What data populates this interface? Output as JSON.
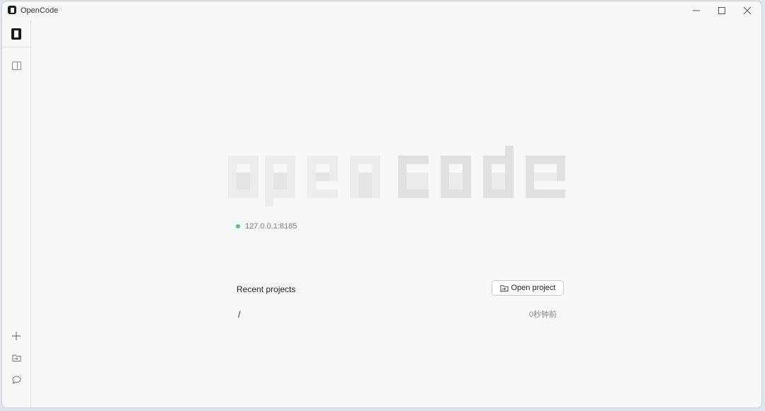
{
  "window": {
    "title": "OpenCode",
    "controls": [
      "minimize-icon",
      "maximize-icon",
      "close-icon"
    ]
  },
  "sidebar": {
    "top_icons": [
      "app-logo-icon",
      "toggle-sidebar-icon"
    ],
    "bottom_icons": [
      "plus-icon",
      "folder-open-icon",
      "chat-bubble-icon"
    ]
  },
  "main": {
    "logo_text": "opencode",
    "server": {
      "address": "127.0.0.1:8185",
      "status_color": "#5fc56a"
    },
    "recent": {
      "title": "Recent projects",
      "open_project_label": "Open project",
      "projects": [
        {
          "path": "/",
          "time": "0秒钟前"
        }
      ]
    }
  }
}
